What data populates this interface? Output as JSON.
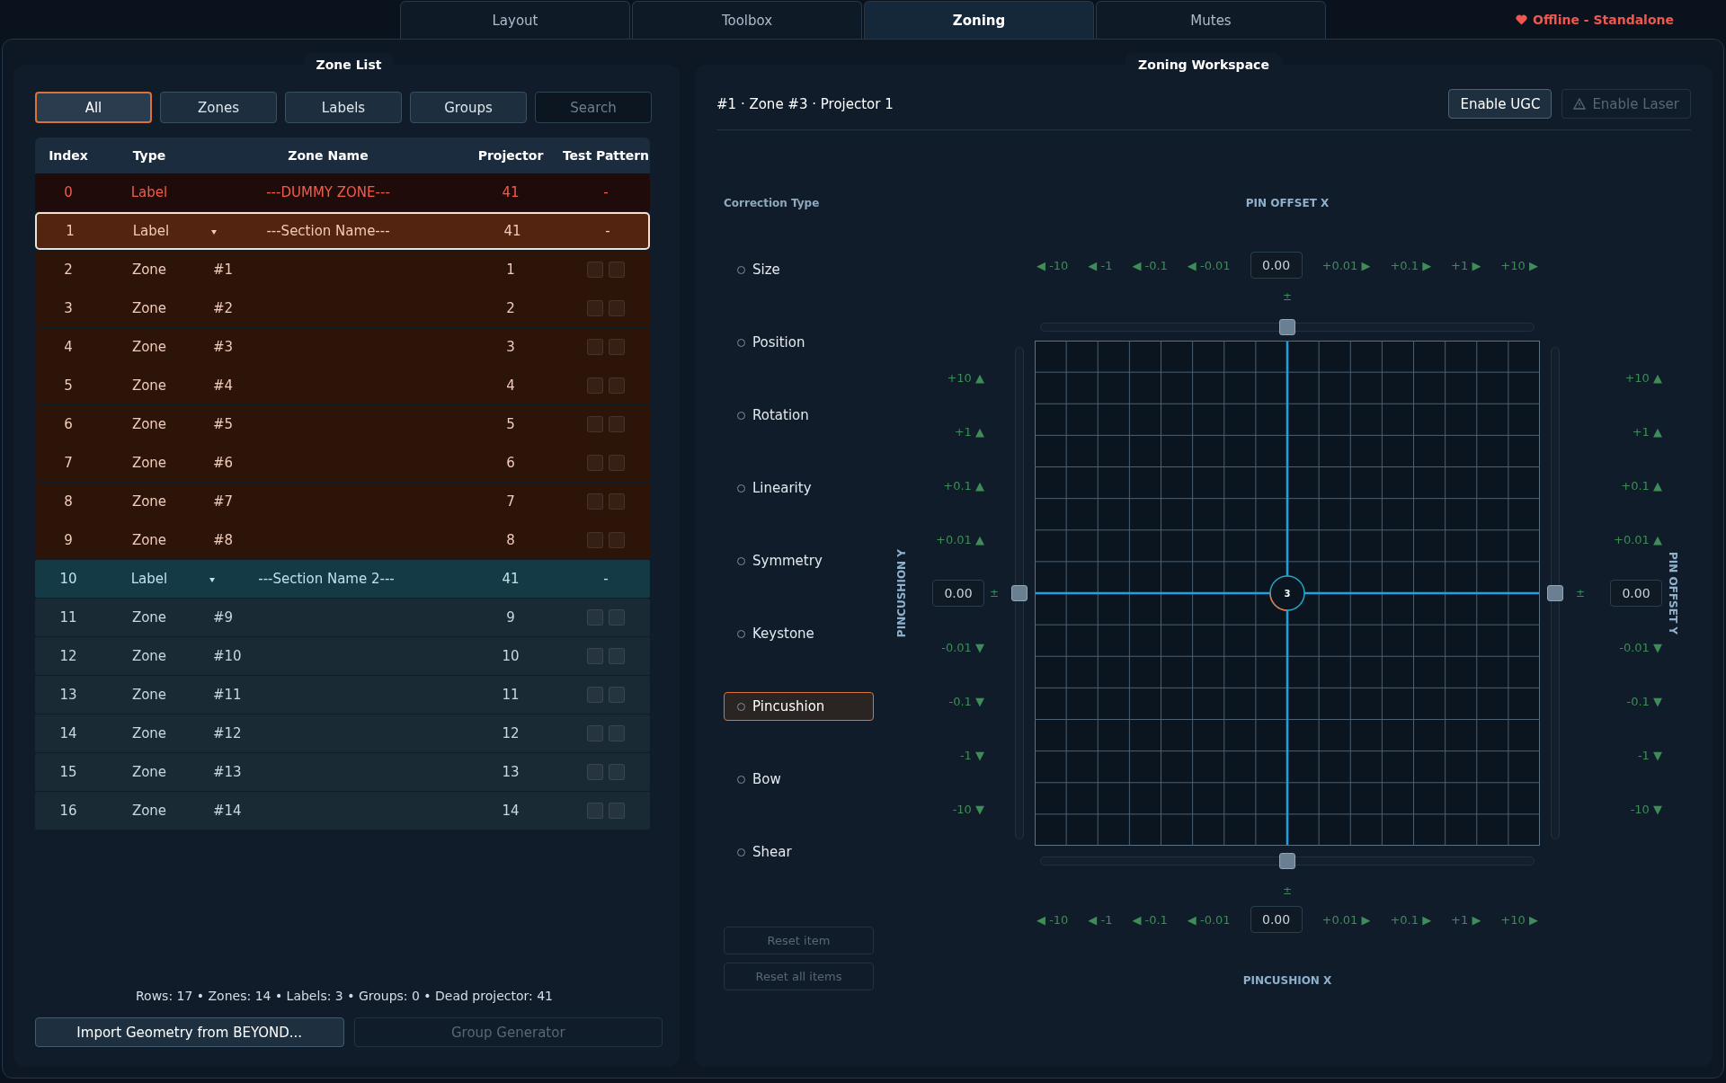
{
  "tabs": [
    {
      "label": "Layout",
      "selected": false
    },
    {
      "label": "Toolbox",
      "selected": false
    },
    {
      "label": "Zoning",
      "selected": true
    },
    {
      "label": "Mutes",
      "selected": false
    }
  ],
  "status": {
    "text": "Offline - Standalone"
  },
  "zone_list": {
    "title": "Zone List",
    "filters": [
      {
        "label": "All",
        "selected": true
      },
      {
        "label": "Zones",
        "selected": false
      },
      {
        "label": "Labels",
        "selected": false
      },
      {
        "label": "Groups",
        "selected": false
      }
    ],
    "search": {
      "placeholder": "Search"
    },
    "columns": [
      "Index",
      "Type",
      "Zone Name",
      "Projector",
      "Test Pattern"
    ],
    "rows": [
      {
        "kind": "dummy",
        "index": "0",
        "type": "Label",
        "name": "---DUMMY ZONE---",
        "projector": "41",
        "test_pattern": "-",
        "color": "#1f0b09",
        "selected": false
      },
      {
        "kind": "label",
        "index": "1",
        "type": "Label",
        "name": "---Section Name---",
        "projector": "41",
        "test_pattern": "-",
        "color": "#532410",
        "selected": true
      },
      {
        "kind": "zone",
        "index": "2",
        "type": "Zone",
        "name": "#1",
        "projector": "1",
        "tests": [
          {
            "checked": false
          },
          {
            "checked": false
          }
        ],
        "color": "#2c1409",
        "selected": false
      },
      {
        "kind": "zone",
        "index": "3",
        "type": "Zone",
        "name": "#2",
        "projector": "2",
        "tests": [
          {
            "checked": false
          },
          {
            "checked": false
          }
        ],
        "color": "#2c1409",
        "selected": false
      },
      {
        "kind": "zone",
        "index": "4",
        "type": "Zone",
        "name": "#3",
        "projector": "3",
        "tests": [
          {
            "checked": false
          },
          {
            "checked": false
          }
        ],
        "color": "#2c1409",
        "selected": false
      },
      {
        "kind": "zone",
        "index": "5",
        "type": "Zone",
        "name": "#4",
        "projector": "4",
        "tests": [
          {
            "checked": false
          },
          {
            "checked": false
          }
        ],
        "color": "#2c1409",
        "selected": false
      },
      {
        "kind": "zone",
        "index": "6",
        "type": "Zone",
        "name": "#5",
        "projector": "5",
        "tests": [
          {
            "checked": false
          },
          {
            "checked": false
          }
        ],
        "color": "#2c1409",
        "selected": false
      },
      {
        "kind": "zone",
        "index": "7",
        "type": "Zone",
        "name": "#6",
        "projector": "6",
        "tests": [
          {
            "checked": false
          },
          {
            "checked": false
          }
        ],
        "color": "#2c1409",
        "selected": false
      },
      {
        "kind": "zone",
        "index": "8",
        "type": "Zone",
        "name": "#7",
        "projector": "7",
        "tests": [
          {
            "checked": false
          },
          {
            "checked": false
          }
        ],
        "color": "#2c1409",
        "selected": false
      },
      {
        "kind": "zone",
        "index": "9",
        "type": "Zone",
        "name": "#8",
        "projector": "8",
        "tests": [
          {
            "checked": false
          },
          {
            "checked": false
          }
        ],
        "color": "#2c1409",
        "selected": false
      },
      {
        "kind": "label",
        "index": "10",
        "type": "Label",
        "name": "---Section Name 2---",
        "projector": "41",
        "test_pattern": "-",
        "color": "#143a46",
        "selected": false
      },
      {
        "kind": "zone",
        "index": "11",
        "type": "Zone",
        "name": "#9",
        "projector": "9",
        "tests": [
          {
            "checked": false
          },
          {
            "checked": false
          }
        ],
        "color": "#1a2a35",
        "selected": false
      },
      {
        "kind": "zone",
        "index": "12",
        "type": "Zone",
        "name": "#10",
        "projector": "10",
        "tests": [
          {
            "checked": false
          },
          {
            "checked": false
          }
        ],
        "color": "#1a2a35",
        "selected": false
      },
      {
        "kind": "zone",
        "index": "13",
        "type": "Zone",
        "name": "#11",
        "projector": "11",
        "tests": [
          {
            "checked": false
          },
          {
            "checked": false
          }
        ],
        "color": "#1a2a35",
        "selected": false
      },
      {
        "kind": "zone",
        "index": "14",
        "type": "Zone",
        "name": "#12",
        "projector": "12",
        "tests": [
          {
            "checked": false
          },
          {
            "checked": false
          }
        ],
        "color": "#1a2a35",
        "selected": false
      },
      {
        "kind": "zone",
        "index": "15",
        "type": "Zone",
        "name": "#13",
        "projector": "13",
        "tests": [
          {
            "checked": false
          },
          {
            "checked": false
          }
        ],
        "color": "#1a2a35",
        "selected": false
      },
      {
        "kind": "zone",
        "index": "16",
        "type": "Zone",
        "name": "#14",
        "projector": "14",
        "tests": [
          {
            "checked": false
          },
          {
            "checked": false
          }
        ],
        "color": "#1a2a35",
        "selected": false
      }
    ],
    "summary": "Rows: 17 • Zones: 14 • Labels: 3 • Groups: 0 • Dead projector: 41",
    "buttons": [
      {
        "label": "Import Geometry from BEYOND...",
        "disabled": false
      },
      {
        "label": "Group Generator",
        "disabled": true
      }
    ]
  },
  "workspace": {
    "title": "Zoning Workspace",
    "breadcrumb": "#1 · Zone #3 · Projector 1",
    "buttons": [
      {
        "kind": "plain",
        "label": "Enable UGC",
        "disabled": false
      },
      {
        "kind": "warning",
        "label": "Enable Laser",
        "disabled": true
      }
    ],
    "correction_title": "Correction Type",
    "corrections": [
      {
        "label": "Size",
        "selected": false
      },
      {
        "label": "Position",
        "selected": false
      },
      {
        "label": "Rotation",
        "selected": false
      },
      {
        "label": "Linearity",
        "selected": false
      },
      {
        "label": "Symmetry",
        "selected": false
      },
      {
        "label": "Keystone",
        "selected": false
      },
      {
        "label": "Pincushion",
        "selected": true
      },
      {
        "label": "Bow",
        "selected": false
      },
      {
        "label": "Shear",
        "selected": false
      }
    ],
    "reset_buttons": [
      {
        "label": "Reset item",
        "disabled": true
      },
      {
        "label": "Reset all items",
        "disabled": true
      }
    ],
    "axes": [
      {
        "kind": "top",
        "title": "PIN OFFSET X",
        "value": "0.00",
        "plus_minus": "±",
        "level": 0.5,
        "steps_before": [
          "◀ -10",
          "◀ -1",
          "◀ -0.1",
          "◀ -0.01"
        ],
        "steps_after": [
          "+0.01 ▶",
          "+0.1 ▶",
          "+1 ▶",
          "+10 ▶"
        ]
      },
      {
        "kind": "left",
        "title": "PINCUSHION Y",
        "value": "0.00",
        "plus_minus": "±",
        "level": 0.5,
        "steps_before": [
          "+10 ▲",
          "+1 ▲",
          "+0.1 ▲",
          "+0.01 ▲"
        ],
        "steps_after": [
          "-0.01 ▼",
          "-0.1 ▼",
          "-1 ▼",
          "-10 ▼"
        ]
      },
      {
        "kind": "right",
        "title": "PIN OFFSET Y",
        "value": "0.00",
        "plus_minus": "±",
        "level": 0.5,
        "steps_before": [
          "+10 ▲",
          "+1 ▲",
          "+0.1 ▲",
          "+0.01 ▲"
        ],
        "steps_after": [
          "-0.01 ▼",
          "-0.1 ▼",
          "-1 ▼",
          "-10 ▼"
        ]
      },
      {
        "kind": "bottom",
        "title": "PINCUSHION X",
        "value": "0.00",
        "plus_minus": "±",
        "level": 0.5,
        "steps_before": [
          "◀ -10",
          "◀ -1",
          "◀ -0.1",
          "◀ -0.01"
        ],
        "steps_after": [
          "+0.01 ▶",
          "+0.1 ▶",
          "+1 ▶",
          "+10 ▶"
        ]
      }
    ],
    "point": {
      "label": "3"
    }
  }
}
